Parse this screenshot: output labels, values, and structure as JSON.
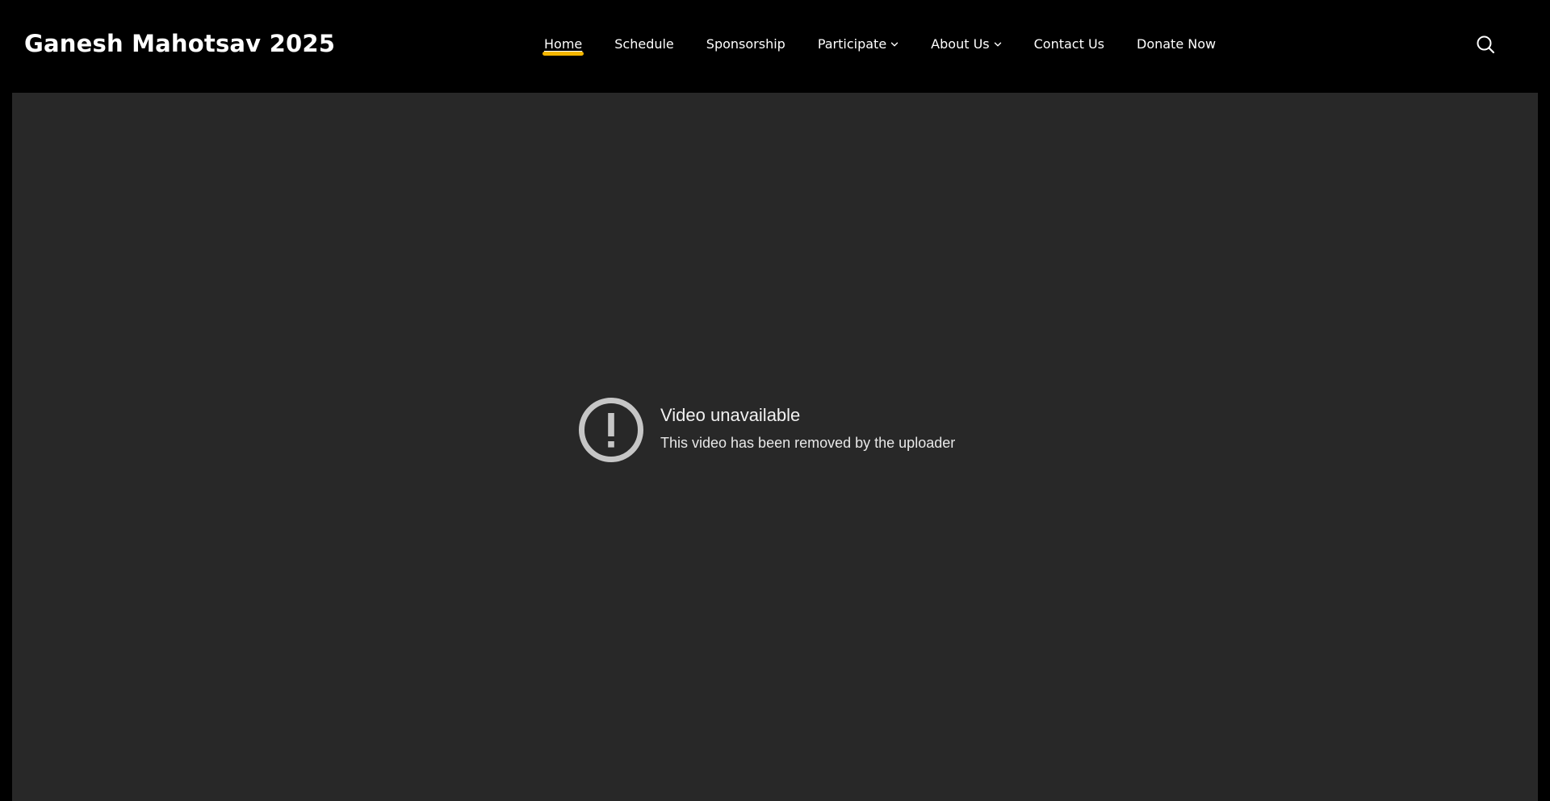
{
  "header": {
    "site_title": "Ganesh Mahotsav 2025",
    "nav": [
      {
        "label": "Home",
        "active": true,
        "has_dropdown": false
      },
      {
        "label": "Schedule",
        "active": false,
        "has_dropdown": false
      },
      {
        "label": "Sponsorship",
        "active": false,
        "has_dropdown": false
      },
      {
        "label": "Participate",
        "active": false,
        "has_dropdown": true
      },
      {
        "label": "About Us",
        "active": false,
        "has_dropdown": true
      },
      {
        "label": "Contact Us",
        "active": false,
        "has_dropdown": false
      },
      {
        "label": "Donate Now",
        "active": false,
        "has_dropdown": false
      }
    ],
    "search_icon": "search-icon",
    "accent_color": "#f5b700"
  },
  "video": {
    "icon": "alert-circle-icon",
    "title": "Video unavailable",
    "message": "This video has been removed by the uploader"
  },
  "colors": {
    "header_bg": "#000000",
    "video_bg": "#282828",
    "text": "#ffffff"
  }
}
